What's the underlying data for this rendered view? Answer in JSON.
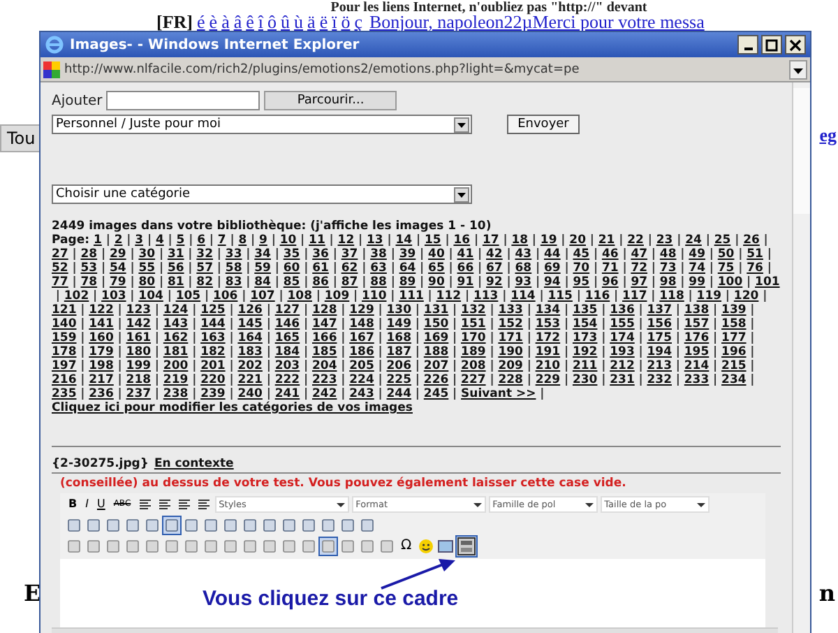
{
  "page": {
    "top_line": "Pour les liens Internet, n'oubliez pas \"http://\" devant",
    "lang_tag": "[FR]",
    "accent_links": [
      "é",
      "è",
      "à",
      "â",
      "ê",
      "î",
      "ô",
      "û",
      "ù",
      "ä",
      "ë",
      "ï",
      "ö",
      "ç"
    ],
    "message_link": "Bonjour, napoleon22µMerci pour votre messa",
    "left_button": "Tou",
    "right_link": "eg",
    "bottom_left": "E",
    "bottom_right": "n"
  },
  "window": {
    "title": "Images- - Windows Internet Explorer",
    "url": "http://www.nlfacile.com/rich2/plugins/emotions2/emotions.php?light=&mycat=pe"
  },
  "upload": {
    "label": "Ajouter",
    "browse_button": "Parcourir...",
    "folder_select": "Personnel / Juste pour moi",
    "send_button": "Envoyer"
  },
  "category_select": "Choisir une catégorie",
  "library": {
    "summary": "2449 images dans votre bibliothèque: (j'affiche les images 1 - 10)",
    "page_label": "Page:",
    "separator": "|",
    "pages": [
      "1",
      "2",
      "3",
      "4",
      "5",
      "6",
      "7",
      "8",
      "9",
      "10",
      "11",
      "12",
      "13",
      "14",
      "15",
      "16",
      "17",
      "18",
      "19",
      "20",
      "21",
      "22",
      "23",
      "24",
      "25",
      "26",
      "27",
      "28",
      "29",
      "30",
      "31",
      "32",
      "33",
      "34",
      "35",
      "36",
      "37",
      "38",
      "39",
      "40",
      "41",
      "42",
      "43",
      "44",
      "45",
      "46",
      "47",
      "48",
      "49",
      "50",
      "51",
      "52",
      "53",
      "54",
      "55",
      "56",
      "57",
      "58",
      "59",
      "60",
      "61",
      "62",
      "63",
      "64",
      "65",
      "66",
      "67",
      "68",
      "69",
      "70",
      "71",
      "72",
      "73",
      "74",
      "75",
      "76",
      "77",
      "78",
      "79",
      "80",
      "81",
      "82",
      "83",
      "84",
      "85",
      "86",
      "87",
      "88",
      "89",
      "90",
      "91",
      "92",
      "93",
      "94",
      "95",
      "96",
      "97",
      "98",
      "99",
      "100",
      "101",
      "102",
      "103",
      "104",
      "105",
      "106",
      "107",
      "108",
      "109",
      "110",
      "111",
      "112",
      "113",
      "114",
      "115",
      "116",
      "117",
      "118",
      "119",
      "120",
      "121",
      "122",
      "123",
      "124",
      "125",
      "126",
      "127",
      "128",
      "129",
      "130",
      "131",
      "132",
      "133",
      "134",
      "135",
      "136",
      "137",
      "138",
      "139",
      "140",
      "141",
      "142",
      "143",
      "144",
      "145",
      "146",
      "147",
      "148",
      "149",
      "150",
      "151",
      "152",
      "153",
      "154",
      "155",
      "156",
      "157",
      "158",
      "159",
      "160",
      "161",
      "162",
      "163",
      "164",
      "165",
      "166",
      "167",
      "168",
      "169",
      "170",
      "171",
      "172",
      "173",
      "174",
      "175",
      "176",
      "177",
      "178",
      "179",
      "180",
      "181",
      "182",
      "183",
      "184",
      "185",
      "186",
      "187",
      "188",
      "189",
      "190",
      "191",
      "192",
      "193",
      "194",
      "195",
      "196",
      "197",
      "198",
      "199",
      "200",
      "201",
      "202",
      "203",
      "204",
      "205",
      "206",
      "207",
      "208",
      "209",
      "210",
      "211",
      "212",
      "213",
      "214",
      "215",
      "216",
      "217",
      "218",
      "219",
      "220",
      "221",
      "222",
      "223",
      "224",
      "225",
      "226",
      "227",
      "228",
      "229",
      "230",
      "231",
      "232",
      "233",
      "234",
      "235",
      "236",
      "237",
      "238",
      "239",
      "240",
      "241",
      "242",
      "243",
      "244",
      "245"
    ],
    "next_link": "Suivant >>",
    "categories_link": "Cliquez ici pour modifier les catégories de vos images"
  },
  "image": {
    "filename": "{2-30275.jpg}",
    "context_link": "En contexte"
  },
  "notice": "(conseillée) au dessus de votre test. Vous pouvez également laisser cette case vide.",
  "editor": {
    "format_buttons": [
      "B",
      "I",
      "U",
      "ABC"
    ],
    "selects": [
      "Styles",
      "Format",
      "Famille de pol",
      "Taille de la po"
    ],
    "special_char": "Ω",
    "annotation": "Vous cliquez sur ce cadre"
  }
}
